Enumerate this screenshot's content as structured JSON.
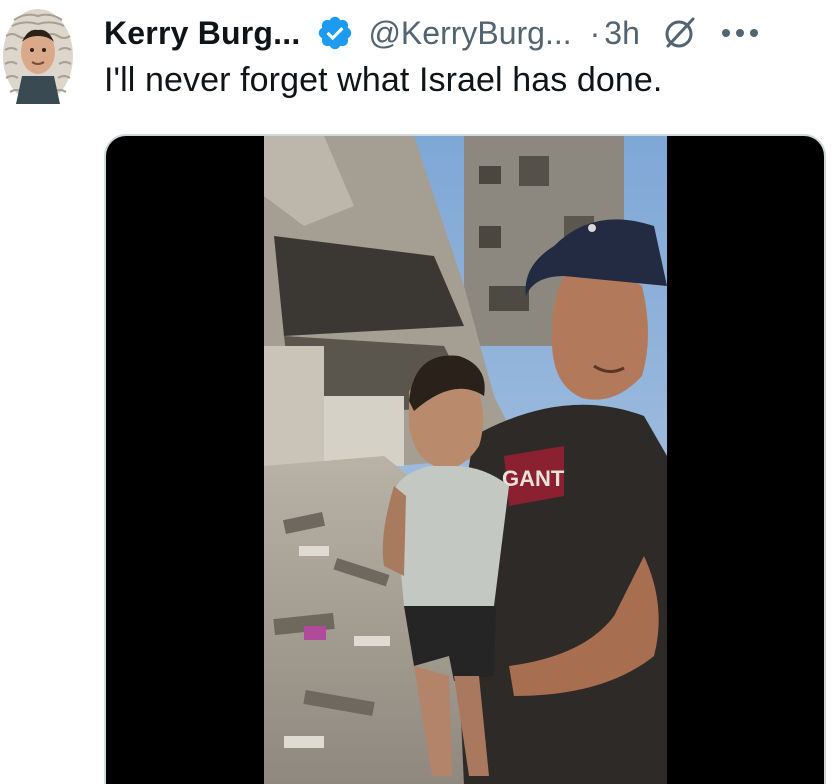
{
  "tweet": {
    "author": {
      "display_name": "Kerry Burg...",
      "handle": "@KerryBurg...",
      "verified": true,
      "verified_color": "#1d9bf0",
      "avatar_icon": "judge-wig-avatar"
    },
    "separator": "·",
    "time_ago": "3h",
    "text": "I'll never forget what Israel has done.",
    "actions": {
      "grok_icon": "grok-icon",
      "more_icon": "more-icon"
    },
    "media": {
      "type": "video",
      "description_icon": "video-thumbnail",
      "letterbox_color": "#000000",
      "shirt_text": "GANT"
    }
  },
  "colors": {
    "text_primary": "#0f1419",
    "text_secondary": "#536471",
    "accent": "#1d9bf0",
    "card_border": "#cfd9de"
  }
}
